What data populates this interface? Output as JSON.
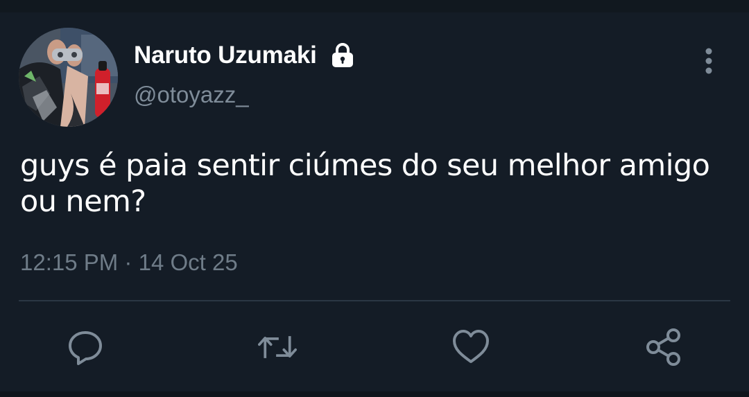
{
  "tweet": {
    "author": {
      "display_name": "Naruto Uzumaki",
      "handle": "@otoyazz_",
      "protected_icon": "lock-icon",
      "avatar": "avatar-photo"
    },
    "text_line1": "guys é paia sentir ciúmes do seu melhor amigo",
    "text_line2": "ou nem?",
    "time": "12:15 PM",
    "separator": "·",
    "date": "14 Oct 25",
    "more_icon": "more-vertical-icon"
  },
  "actions": [
    {
      "icon": "reply-icon"
    },
    {
      "icon": "retweet-icon"
    },
    {
      "icon": "like-icon"
    },
    {
      "icon": "share-icon"
    }
  ],
  "colors": {
    "background": "#141c26",
    "primary_text": "#ffffff",
    "secondary_text": "#7f8c99",
    "icon": "#7f8c99",
    "divider": "#2b3744"
  }
}
